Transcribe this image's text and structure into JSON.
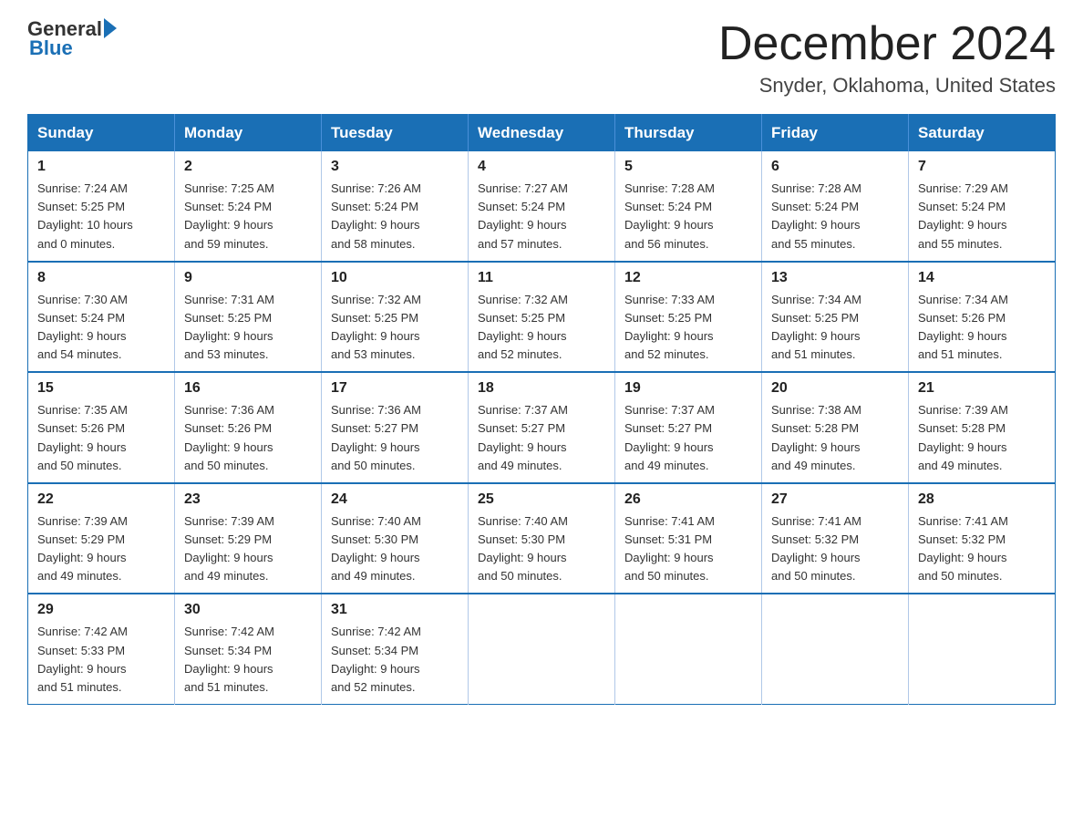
{
  "header": {
    "logo_line1": "General",
    "logo_line2": "Blue",
    "month_title": "December 2024",
    "location": "Snyder, Oklahoma, United States"
  },
  "days_of_week": [
    "Sunday",
    "Monday",
    "Tuesday",
    "Wednesday",
    "Thursday",
    "Friday",
    "Saturday"
  ],
  "weeks": [
    [
      {
        "day": "1",
        "info": "Sunrise: 7:24 AM\nSunset: 5:25 PM\nDaylight: 10 hours\nand 0 minutes."
      },
      {
        "day": "2",
        "info": "Sunrise: 7:25 AM\nSunset: 5:24 PM\nDaylight: 9 hours\nand 59 minutes."
      },
      {
        "day": "3",
        "info": "Sunrise: 7:26 AM\nSunset: 5:24 PM\nDaylight: 9 hours\nand 58 minutes."
      },
      {
        "day": "4",
        "info": "Sunrise: 7:27 AM\nSunset: 5:24 PM\nDaylight: 9 hours\nand 57 minutes."
      },
      {
        "day": "5",
        "info": "Sunrise: 7:28 AM\nSunset: 5:24 PM\nDaylight: 9 hours\nand 56 minutes."
      },
      {
        "day": "6",
        "info": "Sunrise: 7:28 AM\nSunset: 5:24 PM\nDaylight: 9 hours\nand 55 minutes."
      },
      {
        "day": "7",
        "info": "Sunrise: 7:29 AM\nSunset: 5:24 PM\nDaylight: 9 hours\nand 55 minutes."
      }
    ],
    [
      {
        "day": "8",
        "info": "Sunrise: 7:30 AM\nSunset: 5:24 PM\nDaylight: 9 hours\nand 54 minutes."
      },
      {
        "day": "9",
        "info": "Sunrise: 7:31 AM\nSunset: 5:25 PM\nDaylight: 9 hours\nand 53 minutes."
      },
      {
        "day": "10",
        "info": "Sunrise: 7:32 AM\nSunset: 5:25 PM\nDaylight: 9 hours\nand 53 minutes."
      },
      {
        "day": "11",
        "info": "Sunrise: 7:32 AM\nSunset: 5:25 PM\nDaylight: 9 hours\nand 52 minutes."
      },
      {
        "day": "12",
        "info": "Sunrise: 7:33 AM\nSunset: 5:25 PM\nDaylight: 9 hours\nand 52 minutes."
      },
      {
        "day": "13",
        "info": "Sunrise: 7:34 AM\nSunset: 5:25 PM\nDaylight: 9 hours\nand 51 minutes."
      },
      {
        "day": "14",
        "info": "Sunrise: 7:34 AM\nSunset: 5:26 PM\nDaylight: 9 hours\nand 51 minutes."
      }
    ],
    [
      {
        "day": "15",
        "info": "Sunrise: 7:35 AM\nSunset: 5:26 PM\nDaylight: 9 hours\nand 50 minutes."
      },
      {
        "day": "16",
        "info": "Sunrise: 7:36 AM\nSunset: 5:26 PM\nDaylight: 9 hours\nand 50 minutes."
      },
      {
        "day": "17",
        "info": "Sunrise: 7:36 AM\nSunset: 5:27 PM\nDaylight: 9 hours\nand 50 minutes."
      },
      {
        "day": "18",
        "info": "Sunrise: 7:37 AM\nSunset: 5:27 PM\nDaylight: 9 hours\nand 49 minutes."
      },
      {
        "day": "19",
        "info": "Sunrise: 7:37 AM\nSunset: 5:27 PM\nDaylight: 9 hours\nand 49 minutes."
      },
      {
        "day": "20",
        "info": "Sunrise: 7:38 AM\nSunset: 5:28 PM\nDaylight: 9 hours\nand 49 minutes."
      },
      {
        "day": "21",
        "info": "Sunrise: 7:39 AM\nSunset: 5:28 PM\nDaylight: 9 hours\nand 49 minutes."
      }
    ],
    [
      {
        "day": "22",
        "info": "Sunrise: 7:39 AM\nSunset: 5:29 PM\nDaylight: 9 hours\nand 49 minutes."
      },
      {
        "day": "23",
        "info": "Sunrise: 7:39 AM\nSunset: 5:29 PM\nDaylight: 9 hours\nand 49 minutes."
      },
      {
        "day": "24",
        "info": "Sunrise: 7:40 AM\nSunset: 5:30 PM\nDaylight: 9 hours\nand 49 minutes."
      },
      {
        "day": "25",
        "info": "Sunrise: 7:40 AM\nSunset: 5:30 PM\nDaylight: 9 hours\nand 50 minutes."
      },
      {
        "day": "26",
        "info": "Sunrise: 7:41 AM\nSunset: 5:31 PM\nDaylight: 9 hours\nand 50 minutes."
      },
      {
        "day": "27",
        "info": "Sunrise: 7:41 AM\nSunset: 5:32 PM\nDaylight: 9 hours\nand 50 minutes."
      },
      {
        "day": "28",
        "info": "Sunrise: 7:41 AM\nSunset: 5:32 PM\nDaylight: 9 hours\nand 50 minutes."
      }
    ],
    [
      {
        "day": "29",
        "info": "Sunrise: 7:42 AM\nSunset: 5:33 PM\nDaylight: 9 hours\nand 51 minutes."
      },
      {
        "day": "30",
        "info": "Sunrise: 7:42 AM\nSunset: 5:34 PM\nDaylight: 9 hours\nand 51 minutes."
      },
      {
        "day": "31",
        "info": "Sunrise: 7:42 AM\nSunset: 5:34 PM\nDaylight: 9 hours\nand 52 minutes."
      },
      {
        "day": "",
        "info": ""
      },
      {
        "day": "",
        "info": ""
      },
      {
        "day": "",
        "info": ""
      },
      {
        "day": "",
        "info": ""
      }
    ]
  ]
}
